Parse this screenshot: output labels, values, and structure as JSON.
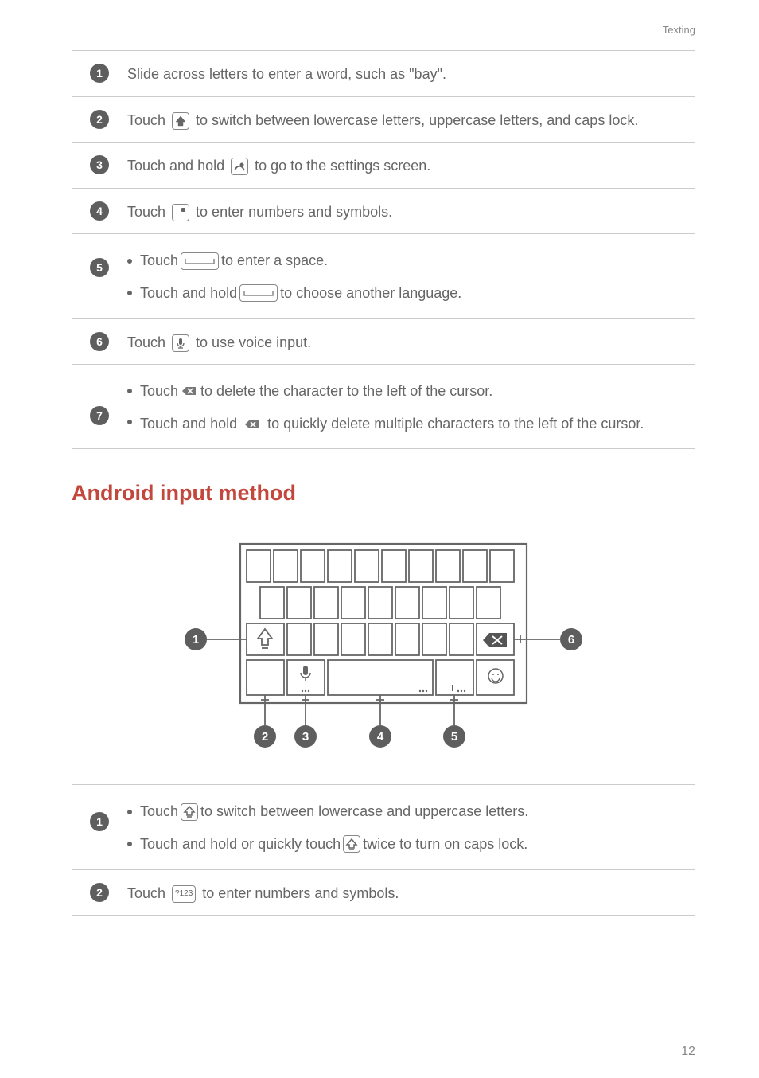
{
  "header": {
    "section_label": "Texting"
  },
  "table1": {
    "rows": [
      {
        "n": "1",
        "type": "plain",
        "text": "Slide across letters to enter a word, such as \"bay\"."
      },
      {
        "n": "2",
        "type": "icon_mid",
        "pre": "Touch ",
        "icon": "shift-arrow",
        "post": " to switch between lowercase letters, uppercase letters, and caps lock."
      },
      {
        "n": "3",
        "type": "icon_mid",
        "pre": "Touch and hold ",
        "icon": "swype-gear",
        "post": " to go to the settings screen."
      },
      {
        "n": "4",
        "type": "icon_mid",
        "pre": "Touch ",
        "icon": "sym-key",
        "post": " to enter numbers and symbols."
      },
      {
        "n": "5",
        "type": "bullets",
        "bullets": [
          {
            "pre": "Touch ",
            "icon": "space-wide",
            "post": " to enter a space."
          },
          {
            "pre": "Touch and hold ",
            "icon": "space-wide",
            "post": " to choose another language."
          }
        ]
      },
      {
        "n": "6",
        "type": "icon_mid",
        "pre": "Touch ",
        "icon": "mic-key",
        "post": " to use voice input."
      },
      {
        "n": "7",
        "type": "bullets",
        "bullets": [
          {
            "pre": "Touch ",
            "icon": "del-dark",
            "post": " to delete the character to the left of the cursor."
          },
          {
            "pre": "Touch and hold ",
            "icon": "del-dark",
            "post": " to quickly delete multiple characters to the left of the cursor.",
            "wrap_tail": true
          }
        ]
      }
    ]
  },
  "heading": {
    "text": "Android input method"
  },
  "kbd_callouts": {
    "c1": "1",
    "c2": "2",
    "c3": "3",
    "c4": "4",
    "c5": "5",
    "c6": "6"
  },
  "table2": {
    "rows": [
      {
        "n": "1",
        "type": "bullets",
        "bullets": [
          {
            "pre": "Touch ",
            "icon": "shift-outline",
            "post": " to switch between lowercase and uppercase letters."
          },
          {
            "pre": "Touch and hold or quickly touch ",
            "icon": "shift-outline",
            "post": " twice to turn on caps lock."
          }
        ]
      },
      {
        "n": "2",
        "type": "icon_mid",
        "pre": "Touch ",
        "icon": "q123",
        "post": " to enter numbers and symbols."
      }
    ]
  },
  "icon_text": {
    "q123": "?123"
  },
  "page": {
    "number": "12"
  }
}
